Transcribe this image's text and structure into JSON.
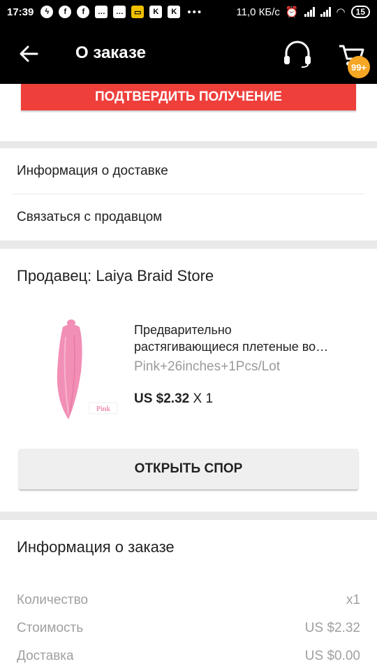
{
  "status_bar": {
    "time": "17:39",
    "left_icons": [
      "flash-icon",
      "facebook-icon",
      "facebook-icon",
      "chat-icon",
      "chat-icon",
      "tv-icon",
      "k-icon",
      "k-icon"
    ],
    "more": "•••",
    "speed": "11,0 КБ/с",
    "battery": "15"
  },
  "app_bar": {
    "title": "О заказе",
    "cart_badge": "99+"
  },
  "confirm": {
    "label": "ПОДТВЕРДИТЬ ПОЛУЧЕНИЕ",
    "color": "#ee3f3b"
  },
  "menu": {
    "items": [
      {
        "label": "Информация о доставке"
      },
      {
        "label": "Связаться с продавцом"
      }
    ]
  },
  "seller": {
    "name": "Продавец: Laiya Braid Store",
    "product": {
      "title_line1": "Предварительно",
      "title_line2": "растягивающиеся плетеные во…",
      "variant": "Pink+26inches+1Pcs/Lot",
      "price": "US $2.32",
      "qty": "X 1",
      "image_label": "Pink",
      "image_color": "#f28fb6"
    },
    "dispute_label": "ОТКРЫТЬ СПОР"
  },
  "order_info": {
    "title": "Информация о заказе",
    "rows": [
      {
        "label": "Количество",
        "value": "x1"
      },
      {
        "label": "Стоимость",
        "value": "US $2.32"
      },
      {
        "label": "Доставка",
        "value": "US $0.00"
      }
    ]
  }
}
